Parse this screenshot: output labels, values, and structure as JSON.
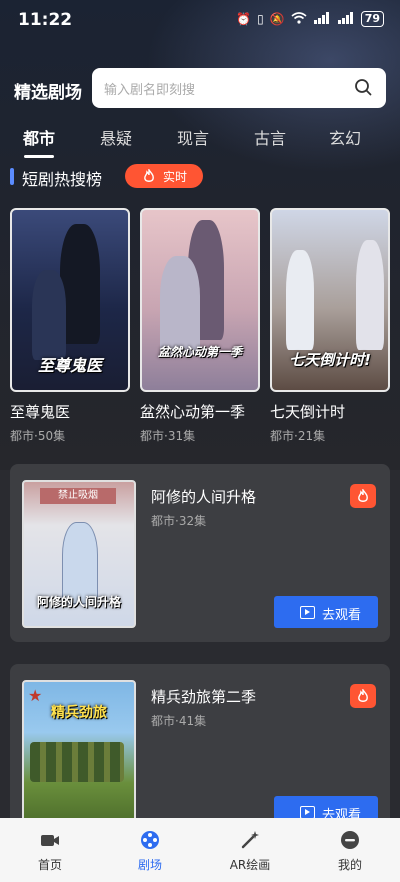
{
  "status_bar": {
    "time": "11:22",
    "battery": "79"
  },
  "header": {
    "title": "精选剧场",
    "search_placeholder": "输入剧名即刻搜"
  },
  "tabs": [
    {
      "label": "都市",
      "active": true
    },
    {
      "label": "悬疑"
    },
    {
      "label": "现言"
    },
    {
      "label": "古言"
    },
    {
      "label": "玄幻"
    }
  ],
  "hot_section": {
    "title": "短剧热搜榜",
    "badge": "实时"
  },
  "hot_list": [
    {
      "name": "至尊鬼医",
      "meta": "都市·50集",
      "poster_title": "至尊鬼医"
    },
    {
      "name": "盆然心动第一季",
      "meta": "都市·31集",
      "poster_title": "盆然心动第一季"
    },
    {
      "name": "七天倒计时",
      "meta": "都市·21集",
      "poster_title": "七天倒计时!"
    }
  ],
  "featured": [
    {
      "name": "阿修的人间升格",
      "meta": "都市·32集",
      "poster_title": "阿修的人间升格",
      "poster_sign": "禁止吸烟",
      "button": "去观看"
    },
    {
      "name": "精兵劲旅第二季",
      "meta": "都市·41集",
      "poster_title": "精兵劲旅",
      "button": "去观看"
    }
  ],
  "bottom_nav": [
    {
      "label": "首页",
      "icon": "video-icon"
    },
    {
      "label": "剧场",
      "icon": "film-reel-icon",
      "active": true
    },
    {
      "label": "AR绘画",
      "icon": "magic-wand-icon"
    },
    {
      "label": "我的",
      "icon": "profile-icon"
    }
  ],
  "colors": {
    "accent": "#2d6cf0",
    "hot": "#ff5533",
    "section_bar": "#5b8cff"
  }
}
